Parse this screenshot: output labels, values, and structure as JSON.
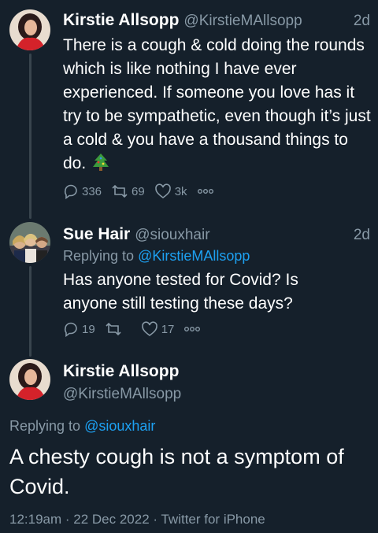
{
  "tweet1": {
    "name": "Kirstie Allsopp",
    "handle": "@KirstieMAllsopp",
    "time": "2d",
    "text": "There is a cough & cold doing the rounds which is like nothing I have ever experienced. If someone you love has it try to be sympathetic, even though it’s just a cold & you have a thousand things to do.",
    "emoji": "christmas-tree-icon",
    "replies": "336",
    "retweets": "69",
    "likes": "3k"
  },
  "tweet2": {
    "name": "Sue Hair",
    "handle": "@siouxhair",
    "time": "2d",
    "replying_prefix": "Replying to ",
    "replying_to": "@KirstieMAllsopp",
    "text": "Has anyone tested for Covid? Is anyone still testing these days?",
    "replies": "19",
    "retweets": "",
    "likes": "17"
  },
  "focus": {
    "name": "Kirstie Allsopp",
    "handle": "@KirstieMAllsopp",
    "replying_prefix": "Replying to ",
    "replying_to": "@siouxhair",
    "text": "A chesty cough is not a symptom of Covid.",
    "timestamp": "12:19am · 22 Dec 2022 · Twitter for iPhone"
  },
  "colors": {
    "background": "#15202b",
    "secondary_text": "#8899a6",
    "link": "#1da1f2",
    "thread_line": "#38444d"
  }
}
